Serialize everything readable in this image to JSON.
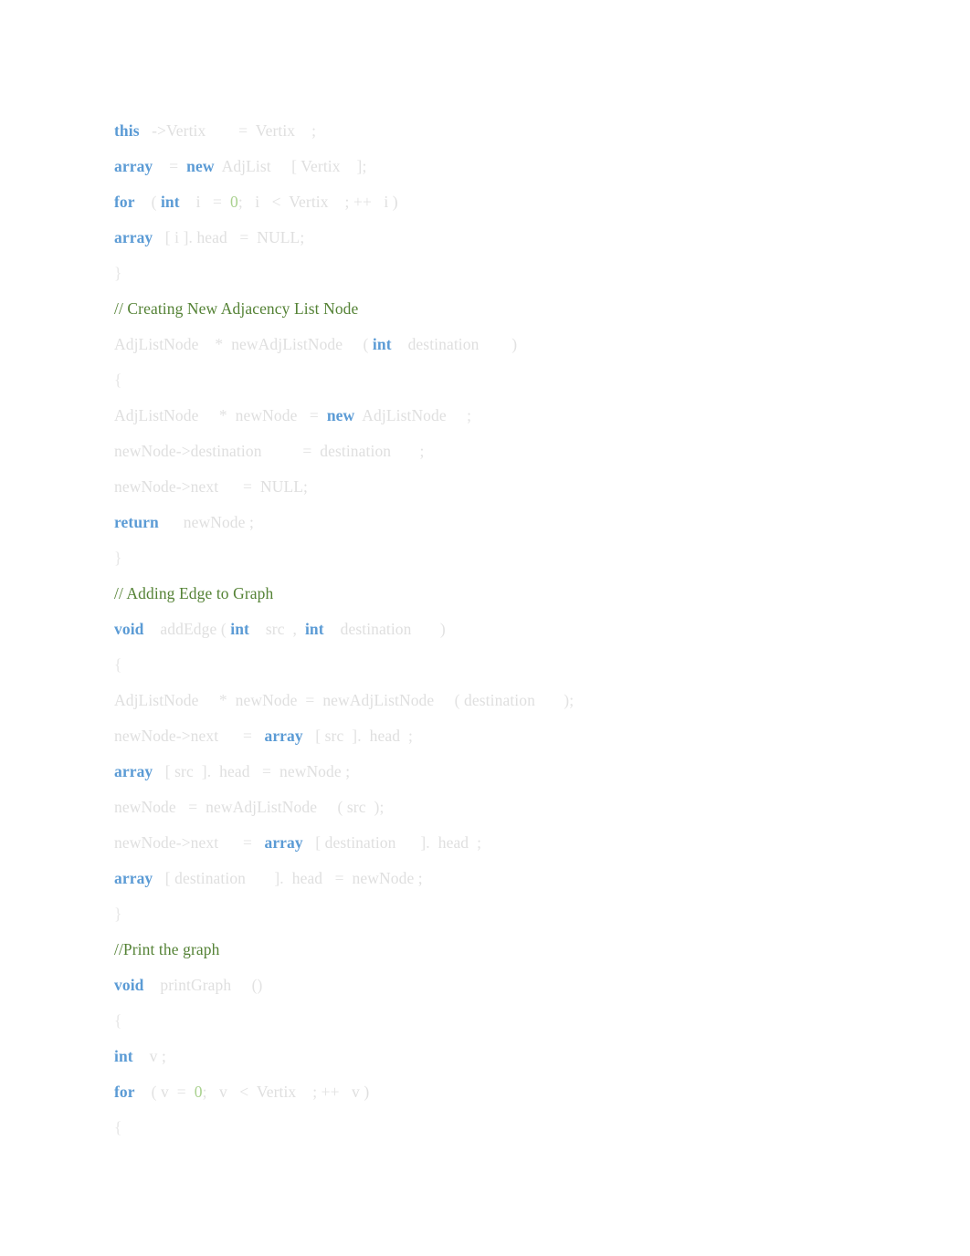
{
  "document": {
    "page_background": "#ffffff",
    "language": "C++",
    "colors": {
      "keyword": "#5b9bd5",
      "identifier": "#dfdfdf",
      "punctuation": "#e2e2e2",
      "number": "#a9d18e",
      "comment": "#548235",
      "brace": "#e6e6e6"
    }
  },
  "code": {
    "lines": [
      {
        "id": "line-1",
        "kind": "code",
        "text": "this   ->Vertix        =  Vertix    ;",
        "tokens": [
          {
            "t": "this",
            "c": "kw"
          },
          {
            "t": "   ",
            "c": "punct"
          },
          {
            "t": "->Vertix",
            "c": "id"
          },
          {
            "t": "        ",
            "c": "punct"
          },
          {
            "t": "=",
            "c": "punct"
          },
          {
            "t": "  ",
            "c": "punct"
          },
          {
            "t": "Vertix",
            "c": "id"
          },
          {
            "t": "    ",
            "c": "punct"
          },
          {
            "t": ";",
            "c": "punct"
          }
        ]
      },
      {
        "id": "line-2",
        "kind": "code",
        "text": "array    =  new  AdjList     [ Vertix    ];",
        "tokens": [
          {
            "t": "array",
            "c": "kw"
          },
          {
            "t": "    ",
            "c": "punct"
          },
          {
            "t": "=",
            "c": "punct"
          },
          {
            "t": "  ",
            "c": "punct"
          },
          {
            "t": "new",
            "c": "kw"
          },
          {
            "t": "  ",
            "c": "punct"
          },
          {
            "t": "AdjList",
            "c": "id"
          },
          {
            "t": "     ",
            "c": "punct"
          },
          {
            "t": "[ ",
            "c": "punct"
          },
          {
            "t": "Vertix",
            "c": "id"
          },
          {
            "t": "    ",
            "c": "punct"
          },
          {
            "t": "];",
            "c": "punct"
          }
        ]
      },
      {
        "id": "line-3",
        "kind": "code",
        "text": "for    ( int    i   =  0;   i   <  Vertix    ; ++   i )",
        "tokens": [
          {
            "t": "for",
            "c": "kw"
          },
          {
            "t": "    ",
            "c": "punct"
          },
          {
            "t": "( ",
            "c": "punct"
          },
          {
            "t": "int",
            "c": "kw"
          },
          {
            "t": "    ",
            "c": "punct"
          },
          {
            "t": "i",
            "c": "id"
          },
          {
            "t": "   ",
            "c": "punct"
          },
          {
            "t": "=",
            "c": "punct"
          },
          {
            "t": "  ",
            "c": "punct"
          },
          {
            "t": "0",
            "c": "num"
          },
          {
            "t": ";",
            "c": "punct"
          },
          {
            "t": "   ",
            "c": "punct"
          },
          {
            "t": "i",
            "c": "id"
          },
          {
            "t": "   ",
            "c": "punct"
          },
          {
            "t": "<",
            "c": "punct"
          },
          {
            "t": "  ",
            "c": "punct"
          },
          {
            "t": "Vertix",
            "c": "id"
          },
          {
            "t": "    ",
            "c": "punct"
          },
          {
            "t": "; ++",
            "c": "punct"
          },
          {
            "t": "   ",
            "c": "punct"
          },
          {
            "t": "i )",
            "c": "id"
          }
        ]
      },
      {
        "id": "line-4",
        "kind": "code",
        "text": "array   [ i ]. head   =  NULL;",
        "tokens": [
          {
            "t": "array",
            "c": "kw"
          },
          {
            "t": "   ",
            "c": "punct"
          },
          {
            "t": "[ i ]. ",
            "c": "punct"
          },
          {
            "t": "head",
            "c": "id"
          },
          {
            "t": "   ",
            "c": "punct"
          },
          {
            "t": "=",
            "c": "punct"
          },
          {
            "t": "  ",
            "c": "punct"
          },
          {
            "t": "NULL;",
            "c": "id"
          }
        ]
      },
      {
        "id": "line-5",
        "kind": "code",
        "text": "}",
        "tokens": [
          {
            "t": "}",
            "c": "brace"
          }
        ]
      },
      {
        "id": "line-6",
        "kind": "comment",
        "text": "// Creating New Adjacency List Node",
        "tokens": [
          {
            "t": "// Creating New Adjacency List Node",
            "c": "comment"
          }
        ]
      },
      {
        "id": "line-7",
        "kind": "code",
        "text": "AdjListNode    *  newAdjListNode     ( int    destination        )",
        "tokens": [
          {
            "t": "AdjListNode",
            "c": "id"
          },
          {
            "t": "    ",
            "c": "punct"
          },
          {
            "t": "*",
            "c": "punct"
          },
          {
            "t": "  ",
            "c": "punct"
          },
          {
            "t": "newAdjListNode",
            "c": "id"
          },
          {
            "t": "     ",
            "c": "punct"
          },
          {
            "t": "( ",
            "c": "punct"
          },
          {
            "t": "int",
            "c": "kw"
          },
          {
            "t": "    ",
            "c": "punct"
          },
          {
            "t": "destination",
            "c": "id"
          },
          {
            "t": "        ",
            "c": "punct"
          },
          {
            "t": ")",
            "c": "punct"
          }
        ]
      },
      {
        "id": "line-8",
        "kind": "code",
        "text": "{",
        "tokens": [
          {
            "t": "{",
            "c": "brace"
          }
        ]
      },
      {
        "id": "line-9",
        "kind": "code",
        "text": "AdjListNode     *  newNode   =  new  AdjListNode     ;",
        "tokens": [
          {
            "t": "AdjListNode",
            "c": "id"
          },
          {
            "t": "     ",
            "c": "punct"
          },
          {
            "t": "*",
            "c": "punct"
          },
          {
            "t": "  ",
            "c": "punct"
          },
          {
            "t": "newNode",
            "c": "id"
          },
          {
            "t": "   ",
            "c": "punct"
          },
          {
            "t": "=",
            "c": "punct"
          },
          {
            "t": "  ",
            "c": "punct"
          },
          {
            "t": "new",
            "c": "kw"
          },
          {
            "t": "  ",
            "c": "punct"
          },
          {
            "t": "AdjListNode",
            "c": "id"
          },
          {
            "t": "     ",
            "c": "punct"
          },
          {
            "t": ";",
            "c": "punct"
          }
        ]
      },
      {
        "id": "line-10",
        "kind": "code",
        "text": "newNode->destination          =  destination       ;",
        "tokens": [
          {
            "t": "newNode->destination",
            "c": "id"
          },
          {
            "t": "          ",
            "c": "punct"
          },
          {
            "t": "=",
            "c": "punct"
          },
          {
            "t": "  ",
            "c": "punct"
          },
          {
            "t": "destination",
            "c": "id"
          },
          {
            "t": "       ",
            "c": "punct"
          },
          {
            "t": ";",
            "c": "punct"
          }
        ]
      },
      {
        "id": "line-11",
        "kind": "code",
        "text": "newNode->next      =  NULL;",
        "tokens": [
          {
            "t": "newNode->next",
            "c": "id"
          },
          {
            "t": "      ",
            "c": "punct"
          },
          {
            "t": "=",
            "c": "punct"
          },
          {
            "t": "  ",
            "c": "punct"
          },
          {
            "t": "NULL;",
            "c": "id"
          }
        ]
      },
      {
        "id": "line-12",
        "kind": "code",
        "text": "return      newNode ;",
        "tokens": [
          {
            "t": "return",
            "c": "kw"
          },
          {
            "t": "      ",
            "c": "punct"
          },
          {
            "t": "newNode ;",
            "c": "id"
          }
        ]
      },
      {
        "id": "line-13",
        "kind": "code",
        "text": "}",
        "tokens": [
          {
            "t": "}",
            "c": "brace"
          }
        ]
      },
      {
        "id": "line-14",
        "kind": "comment",
        "text": "// Adding Edge to Graph",
        "tokens": [
          {
            "t": "// Adding Edge to Graph",
            "c": "comment"
          }
        ]
      },
      {
        "id": "line-15",
        "kind": "code",
        "text": "void    addEdge ( int    src  ,  int    destination       )",
        "tokens": [
          {
            "t": "void",
            "c": "kw"
          },
          {
            "t": "    ",
            "c": "punct"
          },
          {
            "t": "addEdge",
            "c": "id"
          },
          {
            "t": " ( ",
            "c": "punct"
          },
          {
            "t": "int",
            "c": "kw"
          },
          {
            "t": "    ",
            "c": "punct"
          },
          {
            "t": "src",
            "c": "id"
          },
          {
            "t": "  ,  ",
            "c": "punct"
          },
          {
            "t": "int",
            "c": "kw"
          },
          {
            "t": "    ",
            "c": "punct"
          },
          {
            "t": "destination",
            "c": "id"
          },
          {
            "t": "       ",
            "c": "punct"
          },
          {
            "t": ")",
            "c": "punct"
          }
        ]
      },
      {
        "id": "line-16",
        "kind": "code",
        "text": "{",
        "tokens": [
          {
            "t": "{",
            "c": "brace"
          }
        ]
      },
      {
        "id": "line-17",
        "kind": "code",
        "text": "AdjListNode     *  newNode  =  newAdjListNode     ( destination       );",
        "tokens": [
          {
            "t": "AdjListNode",
            "c": "id"
          },
          {
            "t": "     ",
            "c": "punct"
          },
          {
            "t": "*",
            "c": "punct"
          },
          {
            "t": "  ",
            "c": "punct"
          },
          {
            "t": "newNode",
            "c": "id"
          },
          {
            "t": "  ",
            "c": "punct"
          },
          {
            "t": "=",
            "c": "punct"
          },
          {
            "t": "  ",
            "c": "punct"
          },
          {
            "t": "newAdjListNode",
            "c": "id"
          },
          {
            "t": "     ",
            "c": "punct"
          },
          {
            "t": "( ",
            "c": "punct"
          },
          {
            "t": "destination",
            "c": "id"
          },
          {
            "t": "       ",
            "c": "punct"
          },
          {
            "t": ");",
            "c": "punct"
          }
        ]
      },
      {
        "id": "line-18",
        "kind": "code",
        "text": "newNode->next      =   array   [ src  ].  head  ;",
        "tokens": [
          {
            "t": "newNode->next",
            "c": "id"
          },
          {
            "t": "      ",
            "c": "punct"
          },
          {
            "t": "=",
            "c": "punct"
          },
          {
            "t": "   ",
            "c": "punct"
          },
          {
            "t": "array",
            "c": "kw"
          },
          {
            "t": "   ",
            "c": "punct"
          },
          {
            "t": "[ ",
            "c": "punct"
          },
          {
            "t": "src",
            "c": "id"
          },
          {
            "t": "  ]. ",
            "c": "punct"
          },
          {
            "t": " head",
            "c": "id"
          },
          {
            "t": "  ;",
            "c": "punct"
          }
        ]
      },
      {
        "id": "line-19",
        "kind": "code",
        "text": "array   [ src  ].  head   =  newNode ;",
        "tokens": [
          {
            "t": "array",
            "c": "kw"
          },
          {
            "t": "   ",
            "c": "punct"
          },
          {
            "t": "[ ",
            "c": "punct"
          },
          {
            "t": "src",
            "c": "id"
          },
          {
            "t": "  ]. ",
            "c": "punct"
          },
          {
            "t": " head",
            "c": "id"
          },
          {
            "t": "   ",
            "c": "punct"
          },
          {
            "t": "=",
            "c": "punct"
          },
          {
            "t": "  ",
            "c": "punct"
          },
          {
            "t": "newNode ;",
            "c": "id"
          }
        ]
      },
      {
        "id": "line-20",
        "kind": "code",
        "text": "newNode   =  newAdjListNode     ( src  );",
        "tokens": [
          {
            "t": "newNode",
            "c": "id"
          },
          {
            "t": "   ",
            "c": "punct"
          },
          {
            "t": "=",
            "c": "punct"
          },
          {
            "t": "  ",
            "c": "punct"
          },
          {
            "t": "newAdjListNode",
            "c": "id"
          },
          {
            "t": "     ",
            "c": "punct"
          },
          {
            "t": "( ",
            "c": "punct"
          },
          {
            "t": "src",
            "c": "id"
          },
          {
            "t": "  );",
            "c": "punct"
          }
        ]
      },
      {
        "id": "line-21",
        "kind": "code",
        "text": "newNode->next      =   array   [ destination      ].  head  ;",
        "tokens": [
          {
            "t": "newNode->next",
            "c": "id"
          },
          {
            "t": "      ",
            "c": "punct"
          },
          {
            "t": "=",
            "c": "punct"
          },
          {
            "t": "   ",
            "c": "punct"
          },
          {
            "t": "array",
            "c": "kw"
          },
          {
            "t": "   ",
            "c": "punct"
          },
          {
            "t": "[ ",
            "c": "punct"
          },
          {
            "t": "destination",
            "c": "id"
          },
          {
            "t": "      ]. ",
            "c": "punct"
          },
          {
            "t": " head",
            "c": "id"
          },
          {
            "t": "  ;",
            "c": "punct"
          }
        ]
      },
      {
        "id": "line-22",
        "kind": "code",
        "text": "array   [ destination       ].  head   =  newNode ;",
        "tokens": [
          {
            "t": "array",
            "c": "kw"
          },
          {
            "t": "   ",
            "c": "punct"
          },
          {
            "t": "[ ",
            "c": "punct"
          },
          {
            "t": "destination",
            "c": "id"
          },
          {
            "t": "       ]. ",
            "c": "punct"
          },
          {
            "t": " head",
            "c": "id"
          },
          {
            "t": "   ",
            "c": "punct"
          },
          {
            "t": "=",
            "c": "punct"
          },
          {
            "t": "  ",
            "c": "punct"
          },
          {
            "t": "newNode ;",
            "c": "id"
          }
        ]
      },
      {
        "id": "line-23",
        "kind": "code",
        "text": "}",
        "tokens": [
          {
            "t": "}",
            "c": "brace"
          }
        ]
      },
      {
        "id": "line-24",
        "kind": "comment",
        "text": "//Print the graph",
        "tokens": [
          {
            "t": "//Print the graph",
            "c": "comment"
          }
        ]
      },
      {
        "id": "line-25",
        "kind": "code",
        "text": "void    printGraph     ()",
        "tokens": [
          {
            "t": "void",
            "c": "kw"
          },
          {
            "t": "    ",
            "c": "punct"
          },
          {
            "t": "printGraph",
            "c": "id"
          },
          {
            "t": "     ",
            "c": "punct"
          },
          {
            "t": "()",
            "c": "punct"
          }
        ]
      },
      {
        "id": "line-26",
        "kind": "code",
        "text": "{",
        "tokens": [
          {
            "t": "{",
            "c": "brace"
          }
        ]
      },
      {
        "id": "line-27",
        "kind": "code",
        "text": "int    v ;",
        "tokens": [
          {
            "t": "int",
            "c": "kw"
          },
          {
            "t": "    ",
            "c": "punct"
          },
          {
            "t": "v ;",
            "c": "id"
          }
        ]
      },
      {
        "id": "line-28",
        "kind": "code",
        "text": "for    ( v  =  0;   v   <  Vertix    ; ++   v )",
        "tokens": [
          {
            "t": "for",
            "c": "kw"
          },
          {
            "t": "    ",
            "c": "punct"
          },
          {
            "t": "( ",
            "c": "punct"
          },
          {
            "t": "v",
            "c": "id"
          },
          {
            "t": "  ",
            "c": "punct"
          },
          {
            "t": "=",
            "c": "punct"
          },
          {
            "t": "  ",
            "c": "punct"
          },
          {
            "t": "0",
            "c": "num"
          },
          {
            "t": ";",
            "c": "punct"
          },
          {
            "t": "   ",
            "c": "punct"
          },
          {
            "t": "v",
            "c": "id"
          },
          {
            "t": "   ",
            "c": "punct"
          },
          {
            "t": "<",
            "c": "punct"
          },
          {
            "t": "  ",
            "c": "punct"
          },
          {
            "t": "Vertix",
            "c": "id"
          },
          {
            "t": "    ",
            "c": "punct"
          },
          {
            "t": "; ++",
            "c": "punct"
          },
          {
            "t": "   ",
            "c": "punct"
          },
          {
            "t": "v )",
            "c": "id"
          }
        ]
      },
      {
        "id": "line-29",
        "kind": "code",
        "text": "{",
        "tokens": [
          {
            "t": "{",
            "c": "brace"
          }
        ]
      }
    ]
  }
}
